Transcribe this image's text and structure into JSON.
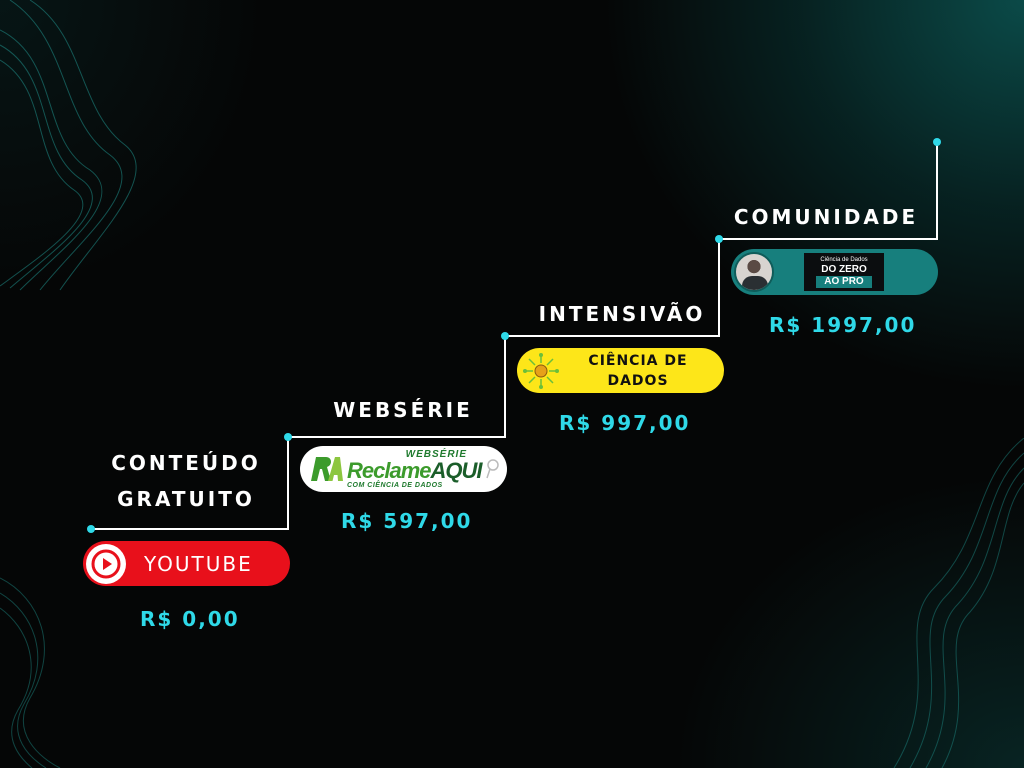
{
  "colors": {
    "accent_line": "#ffffff",
    "node": "#2fd9e8",
    "price": "#2fd9e8",
    "youtube": "#e8101b",
    "intensivo": "#fde619",
    "comunidade": "#177f7d"
  },
  "steps": [
    {
      "title_line1": "CONTEÚDO",
      "title_line2": "GRATUITO",
      "badge": {
        "icon": "youtube-play-icon",
        "label": "YOUTUBE"
      },
      "price": "R$ 0,00"
    },
    {
      "title_line1": "WEBSÉRIE",
      "badge": {
        "icon": "reclame-aqui-logo",
        "top_text": "WEBSÉRIE",
        "brand_a": "Reclame",
        "brand_b": "AQUI",
        "bottom_text": "COM CIÊNCIA DE DADOS"
      },
      "price": "R$ 597,00"
    },
    {
      "title_line1": "INTENSIVÃO",
      "badge": {
        "icon": "data-science-logo",
        "line1": "CIÊNCIA DE",
        "line2": "DADOS"
      },
      "price": "R$ 997,00"
    },
    {
      "title_line1": "COMUNIDADE",
      "badge": {
        "icon": "instructor-avatar",
        "small_text": "Ciência de Dados",
        "big_text": "DO ZERO",
        "pro_text": "AO PRO"
      },
      "price": "R$ 1997,00"
    }
  ]
}
